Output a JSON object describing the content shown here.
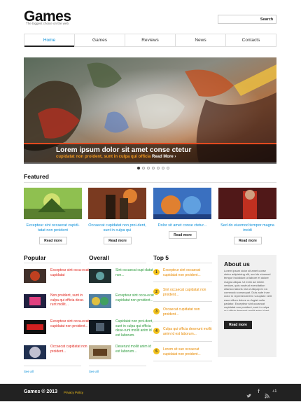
{
  "header": {
    "logo": "Games",
    "tagline": "The biggest choice on the web",
    "search_placeholder": "",
    "search_button": "Search"
  },
  "nav": {
    "items": [
      "Home",
      "Games",
      "Reviews",
      "News",
      "Contacts"
    ]
  },
  "hero": {
    "title": "Lorem ipsum dolor sit amet conse ctetur",
    "subtitle": "cupidatat non proident, sunt in culpa qui officia",
    "read_more": "Read More ›",
    "slide_count": 7,
    "active_slide": 1
  },
  "featured": {
    "title": "Featured",
    "items": [
      {
        "text": "Excepteur sint occaecat cupidi-tatat non proident",
        "button": "Read more"
      },
      {
        "text": "Occaecat cupidatat non proi-dent, sunt in culpa qui",
        "button": "Read more"
      },
      {
        "text": "Dolor sit amet conse ctetur...",
        "button": "Read more"
      },
      {
        "text": "Sed do eiusmod tempor magna incidi",
        "button": "Read more"
      }
    ]
  },
  "popular": {
    "title": "Popular",
    "items": [
      "Excepteur sint occa-ecat cupidatat",
      "Non proident, sunt in culpa qui officia dese-runt mollit...",
      "Excepteur sint occa-ecat cupidatat non proident...",
      "Occaecat cupidatat non proident..."
    ],
    "see_all": "See all"
  },
  "overall": {
    "title": "Overall",
    "items": [
      "Sint occaecat cupi-datat non...",
      "Excepteur sint occa-ecat cupidatat non proident...",
      "Cupidatat non proi-dent, sunt in culpa qui officia dese-runt mollit anim id est laborum.",
      "Deserunt mollit anim id est laborum..."
    ],
    "see_all": "See all"
  },
  "top5": {
    "title": "Top 5",
    "items": [
      {
        "num": "1",
        "text": "Excepteur sint occaecat cupidatat non proident..."
      },
      {
        "num": "2",
        "text": "Sint occaecat cupidatat non proident..."
      },
      {
        "num": "3",
        "text": "Occaecat cupidatat non proident..."
      },
      {
        "num": "4",
        "text": "Culpa qui officia deserunt mollit anim id est laborum..."
      },
      {
        "num": "5",
        "text": "Lorem sit sun occaecat cupidatat non proident..."
      }
    ]
  },
  "about": {
    "title": "About us",
    "text": "Lorem ipsum dolor sit amet conse ctetur adipisicing elit, sed do eiusmod tempor incididunt ut labore et dolore magna aliqua. Ut enim ad minim veniam, quis nostrud exercitation ullamco laboris nisi ut aliquip ex ea commodo consequat. Duis aute irure dolor in reprehenderit in voluptate velit esse cillum dolore eu fugiat nulla pariatur. Excepteur sint occaecat cupidatat non proident, sunt in culpa qui officia deserunt mollit anim id est laborum.",
    "button": "Read more"
  },
  "footer": {
    "copyright": "Games © 2013",
    "privacy": "Privacy Policy",
    "social": [
      "twitter-icon",
      "facebook-icon",
      "rss-icon",
      "google-plus-icon"
    ],
    "gplus_label": "+1"
  },
  "colors": {
    "accent": "#0a8fd8",
    "red": "#e0241b",
    "green": "#2a9a3a",
    "orange": "#e88a00",
    "hero_line": "#e34a1f",
    "badge": "#f3c21b",
    "footer": "#222222"
  }
}
